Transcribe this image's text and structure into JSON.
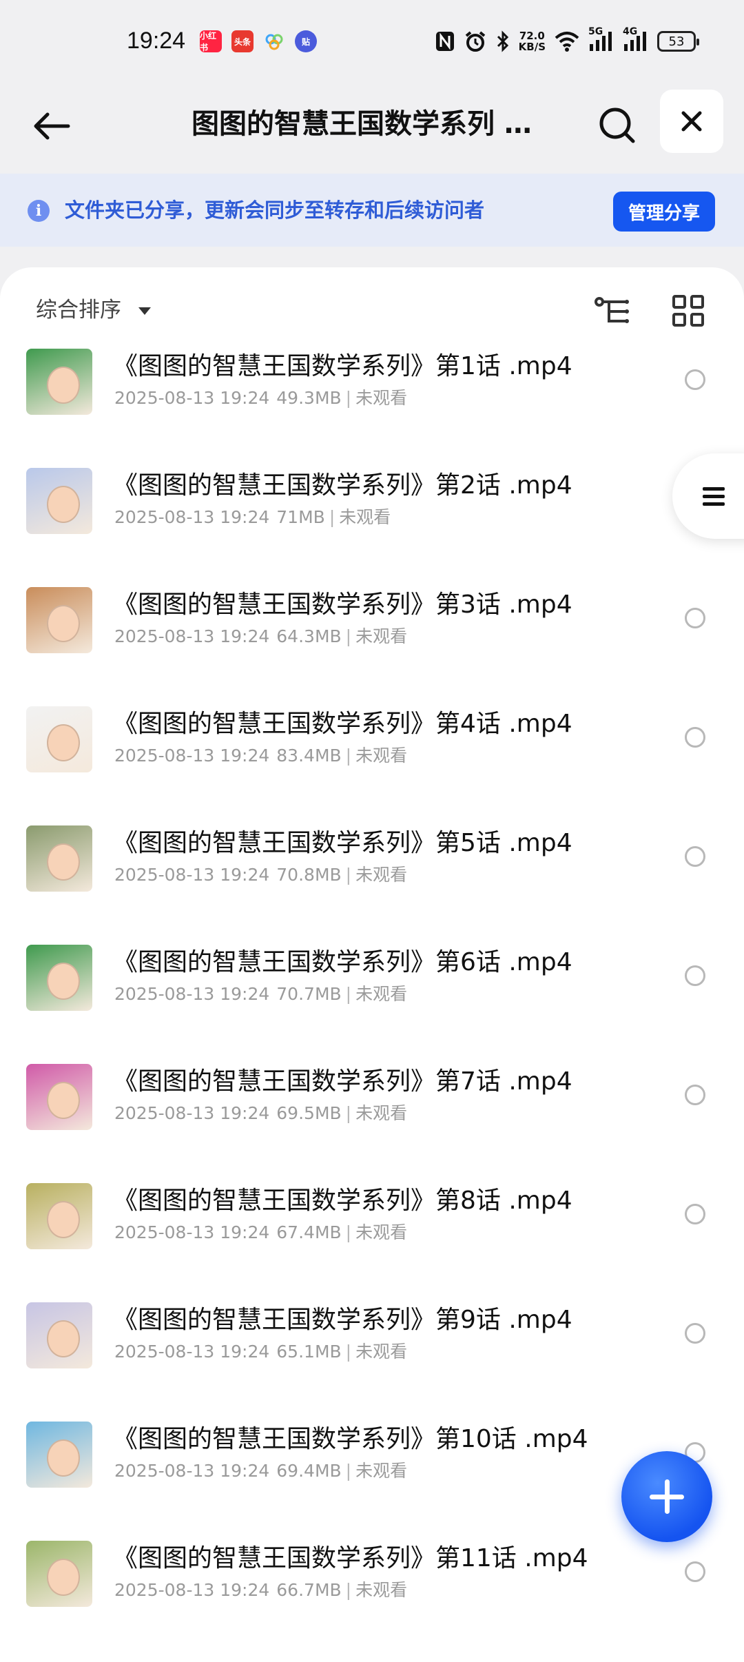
{
  "status_bar": {
    "time": "19:24",
    "notifications": [
      {
        "name": "xiaohongshu-icon",
        "label": "小红书",
        "color": "#ff2442"
      },
      {
        "name": "toutiao-icon",
        "label": "头条",
        "color": "#e8392f"
      },
      {
        "name": "cloud-app-icon",
        "label": "",
        "color": "#3fa6f7"
      },
      {
        "name": "tieba-icon",
        "label": "贴",
        "color": "#4b5bdc"
      }
    ],
    "network_speed_value": "72.0",
    "network_speed_unit": "KB/S",
    "network_5g": "5G",
    "network_4g": "4G",
    "battery": "53"
  },
  "header": {
    "title": "图图的智慧王国数学系列 …"
  },
  "share_banner": {
    "message": "文件夹已分享，更新会同步至转存和后续访问者",
    "manage_label": "管理分享",
    "accent": "#1657f0"
  },
  "toolbar": {
    "sort_label": "综合排序"
  },
  "files": [
    {
      "name": "《图图的智慧王国数学系列》第1话 .mp4",
      "date": "2025-08-13 19:24",
      "size": "49.3MB",
      "status": "未观看",
      "thumb": "#3f9a4e"
    },
    {
      "name": "《图图的智慧王国数学系列》第2话 .mp4",
      "date": "2025-08-13 19:24",
      "size": "71MB",
      "status": "未观看",
      "thumb": "#b9c8ea"
    },
    {
      "name": "《图图的智慧王国数学系列》第3话 .mp4",
      "date": "2025-08-13 19:24",
      "size": "64.3MB",
      "status": "未观看",
      "thumb": "#c98d5b"
    },
    {
      "name": "《图图的智慧王国数学系列》第4话 .mp4",
      "date": "2025-08-13 19:24",
      "size": "83.4MB",
      "status": "未观看",
      "thumb": "#f2f2f2"
    },
    {
      "name": "《图图的智慧王国数学系列》第5话 .mp4",
      "date": "2025-08-13 19:24",
      "size": "70.8MB",
      "status": "未观看",
      "thumb": "#8a9b6e"
    },
    {
      "name": "《图图的智慧王国数学系列》第6话 .mp4",
      "date": "2025-08-13 19:24",
      "size": "70.7MB",
      "status": "未观看",
      "thumb": "#3f9a4e"
    },
    {
      "name": "《图图的智慧王国数学系列》第7话 .mp4",
      "date": "2025-08-13 19:24",
      "size": "69.5MB",
      "status": "未观看",
      "thumb": "#d05aa8"
    },
    {
      "name": "《图图的智慧王国数学系列》第8话 .mp4",
      "date": "2025-08-13 19:24",
      "size": "67.4MB",
      "status": "未观看",
      "thumb": "#b8b060"
    },
    {
      "name": "《图图的智慧王国数学系列》第9话 .mp4",
      "date": "2025-08-13 19:24",
      "size": "65.1MB",
      "status": "未观看",
      "thumb": "#c7c5e4"
    },
    {
      "name": "《图图的智慧王国数学系列》第10话 .mp4",
      "date": "2025-08-13 19:24",
      "size": "69.4MB",
      "status": "未观看",
      "thumb": "#6fb7e0"
    },
    {
      "name": "《图图的智慧王国数学系列》第11话 .mp4",
      "date": "2025-08-13 19:24",
      "size": "66.7MB",
      "status": "未观看",
      "thumb": "#9bb66a"
    }
  ]
}
